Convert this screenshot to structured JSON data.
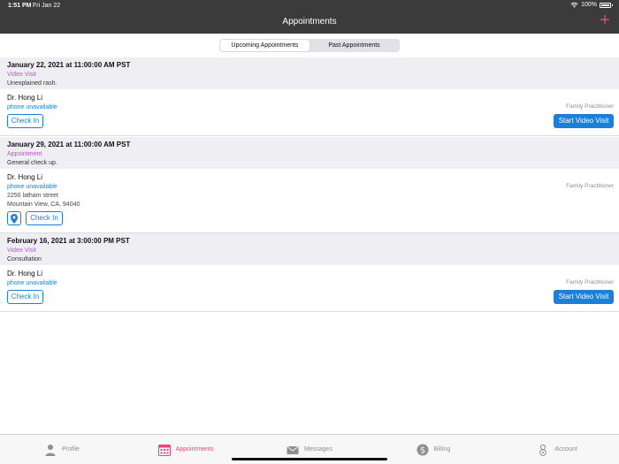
{
  "status": {
    "time": "1:51 PM",
    "date": "Fri Jan 22",
    "battery": "100%"
  },
  "nav": {
    "title": "Appointments",
    "add": "+"
  },
  "segments": [
    "Upcoming Appointments",
    "Past Appointments"
  ],
  "appointments": [
    {
      "date": "January 22, 2021 at 11:00:00 AM PST",
      "type": "Video Visit",
      "reason": "Unexplained rash.",
      "doctor": "Dr. Hong Li",
      "phone": "phone unavailable",
      "specialty": "Family Practitioner",
      "check_in": "Check In",
      "start_video": "Start Video Visit"
    },
    {
      "date": "January 29, 2021 at 11:00:00 AM PST",
      "type": "Appointment",
      "reason": "General check up.",
      "doctor": "Dr. Hong Li",
      "phone": "phone unavailable",
      "address_line1": "2250 latham street",
      "address_line2": "Mountain View, CA, 94040",
      "specialty": "Family Practitioner",
      "check_in": "Check In"
    },
    {
      "date": "February 16, 2021 at 3:00:00 PM PST",
      "type": "Video Visit",
      "reason": "Consultation",
      "doctor": "Dr. Hong Li",
      "phone": "phone unavailable",
      "specialty": "Family Practitioner",
      "check_in": "Check In",
      "start_video": "Start Video Visit"
    }
  ],
  "tabs": [
    {
      "label": "Profile",
      "icon": "person-icon"
    },
    {
      "label": "Appointments",
      "icon": "calendar-icon"
    },
    {
      "label": "Messages",
      "icon": "envelope-icon"
    },
    {
      "label": "Billing",
      "icon": "dollar-icon"
    },
    {
      "label": "Account",
      "icon": "account-icon"
    }
  ],
  "colors": {
    "accent": "#e8467c",
    "link": "#1e7fd6",
    "visit_type": "#b656c8",
    "header": "#3b3b3b"
  }
}
